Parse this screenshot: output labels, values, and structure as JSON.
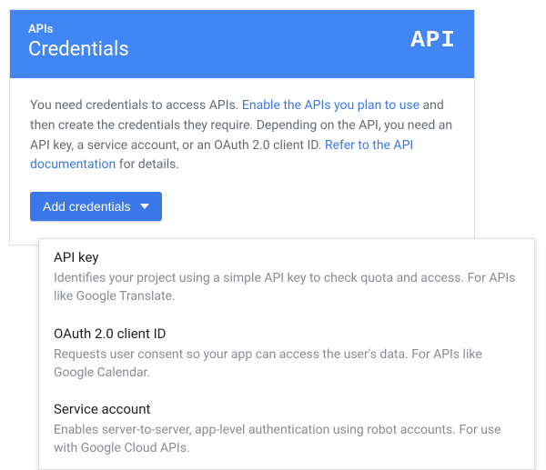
{
  "header": {
    "kicker": "APIs",
    "title": "Credentials",
    "logo_text": "API"
  },
  "intro": {
    "text_before": "You need credentials to access APIs. ",
    "link1": "Enable the APIs you plan to use",
    "text_mid": " and then create the credentials they require. Depending on the API, you need an API key, a service account, or an OAuth 2.0 client ID. ",
    "link2": "Refer to the API documentation",
    "text_after": " for details."
  },
  "button": {
    "add_label": "Add credentials"
  },
  "dropdown": {
    "items": [
      {
        "title": "API key",
        "desc": "Identifies your project using a simple API key to check quota and access. For APIs like Google Translate."
      },
      {
        "title": "OAuth 2.0 client ID",
        "desc": "Requests user consent so your app can access the user's data. For APIs like Google Calendar."
      },
      {
        "title": "Service account",
        "desc": "Enables server-to-server, app-level authentication using robot accounts. For use with Google Cloud APIs."
      }
    ]
  }
}
